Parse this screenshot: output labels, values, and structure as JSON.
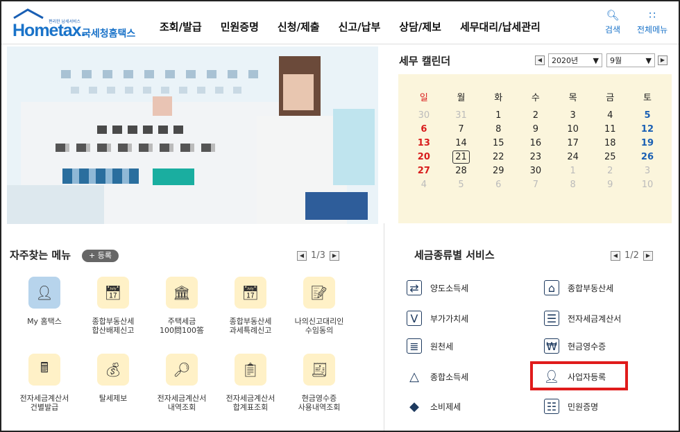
{
  "header": {
    "logo_tag": "편리한 납세서비스",
    "logo_main": "Hometax.",
    "logo_kr": "국세청홈택스",
    "nav": [
      "조회/발급",
      "민원증명",
      "신청/제출",
      "신고/납부",
      "상담/제보",
      "세무대리/납세관리"
    ],
    "search_label": "검색",
    "menu_label": "전체메뉴"
  },
  "calendar": {
    "title": "세무 캘린더",
    "year": "2020년",
    "month": "9월",
    "weekdays": [
      "일",
      "월",
      "화",
      "수",
      "목",
      "금",
      "토"
    ],
    "weeks": [
      [
        "30",
        "31",
        "1",
        "2",
        "3",
        "4",
        "5"
      ],
      [
        "6",
        "7",
        "8",
        "9",
        "10",
        "11",
        "12"
      ],
      [
        "13",
        "14",
        "15",
        "16",
        "17",
        "18",
        "19"
      ],
      [
        "20",
        "21",
        "22",
        "23",
        "24",
        "25",
        "26"
      ],
      [
        "27",
        "28",
        "29",
        "30",
        "1",
        "2",
        "3"
      ],
      [
        "4",
        "5",
        "6",
        "7",
        "8",
        "9",
        "10"
      ]
    ],
    "today": "21"
  },
  "frequent": {
    "title": "자주찾는 메뉴",
    "register": "+ 등록",
    "page": "1/3",
    "items": [
      {
        "label": "My 홈택스",
        "icon": "person-icon"
      },
      {
        "label": "종합부동산세\n합산배제신고",
        "icon": "calendar-pen-icon"
      },
      {
        "label": "주택세금\n100問100答",
        "icon": "building-icon"
      },
      {
        "label": "종합부동산세\n과세특례신고",
        "icon": "calendar-pen-icon"
      },
      {
        "label": "나의신고대리인\n수임동의",
        "icon": "document-pen-icon"
      },
      {
        "label": "전자세금계산서\n건별발급",
        "icon": "calculator-icon"
      },
      {
        "label": "탈세제보",
        "icon": "tax-bag-icon"
      },
      {
        "label": "전자세금계산서\n내역조회",
        "icon": "invoice-search-icon"
      },
      {
        "label": "전자세금계산서\n합계표조회",
        "icon": "invoice-plus-icon"
      },
      {
        "label": "현금영수증\n사용내역조회",
        "icon": "receipt-search-icon"
      }
    ]
  },
  "tax_services": {
    "title": "세금종류별 서비스",
    "page": "1/2",
    "items": [
      {
        "label": "양도소득세",
        "icon": "transfer-icon"
      },
      {
        "label": "종합부동산세",
        "icon": "real-estate-icon"
      },
      {
        "label": "부가가치세",
        "icon": "vat-icon"
      },
      {
        "label": "전자세금계산서",
        "icon": "e-invoice-icon"
      },
      {
        "label": "원천세",
        "icon": "withholding-icon"
      },
      {
        "label": "현금영수증",
        "icon": "cash-receipt-icon"
      },
      {
        "label": "종합소득세",
        "icon": "income-tax-icon"
      },
      {
        "label": "사업자등록",
        "icon": "business-registration-icon"
      },
      {
        "label": "소비제세",
        "icon": "consumption-tax-icon"
      },
      {
        "label": "민원증명",
        "icon": "certificate-icon"
      }
    ]
  },
  "colors": {
    "brand": "#1a73c9",
    "sunday": "#d81c1c",
    "saturday": "#1a5fb4",
    "calendar_bg": "#fbf5dc",
    "highlight": "#e01b1b"
  }
}
